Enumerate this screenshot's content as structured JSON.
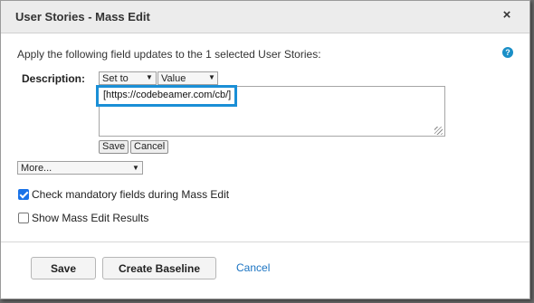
{
  "dialog": {
    "title": "User Stories - Mass Edit",
    "close_icon": "×",
    "intro": "Apply the following field updates to the 1 selected User Stories:",
    "help_icon": "?",
    "description_label": "Description:",
    "operation_selected": "Set to",
    "mode_selected": "Value",
    "description_value": "[https://codebeamer.com/cb/]",
    "save_small_label": "Save",
    "cancel_small_label": "Cancel",
    "more_selected": "More...",
    "check_mandatory_label": "Check mandatory fields during Mass Edit",
    "show_results_label": "Show Mass Edit Results",
    "check_mandatory_checked": true,
    "show_results_checked": false
  },
  "footer": {
    "save_label": "Save",
    "create_baseline_label": "Create Baseline",
    "cancel_label": "Cancel"
  },
  "colors": {
    "highlight": "#1a8fd6",
    "link": "#1a73c2",
    "help": "#1a8fc7"
  }
}
